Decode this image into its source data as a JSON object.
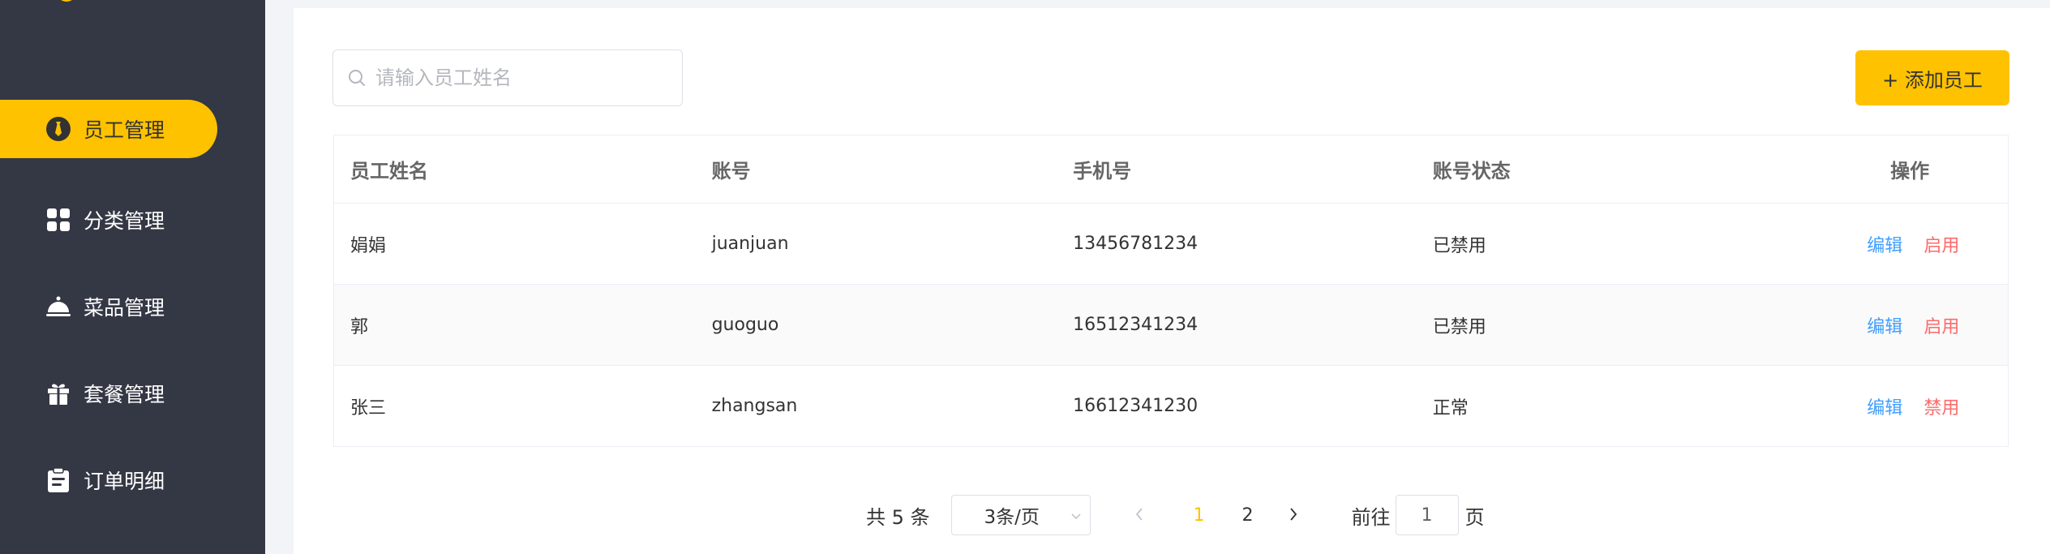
{
  "sidebar": {
    "items": [
      {
        "label": "员工管理",
        "icon": "tie-icon",
        "active": true
      },
      {
        "label": "分类管理",
        "icon": "grid-icon",
        "active": false
      },
      {
        "label": "菜品管理",
        "icon": "cloche-icon",
        "active": false
      },
      {
        "label": "套餐管理",
        "icon": "gift-icon",
        "active": false
      },
      {
        "label": "订单明细",
        "icon": "clipboard-icon",
        "active": false
      }
    ]
  },
  "search": {
    "placeholder": "请输入员工姓名",
    "value": ""
  },
  "toolbar": {
    "add_label": "+ 添加员工"
  },
  "table": {
    "columns": [
      "员工姓名",
      "账号",
      "手机号",
      "账号状态",
      "操作"
    ],
    "rows": [
      {
        "name": "娟娟",
        "account": "juanjuan",
        "phone": "13456781234",
        "status": "已禁用",
        "edit": "编辑",
        "toggle": "启用"
      },
      {
        "name": "郭",
        "account": "guoguo",
        "phone": "16512341234",
        "status": "已禁用",
        "edit": "编辑",
        "toggle": "启用"
      },
      {
        "name": "张三",
        "account": "zhangsan",
        "phone": "16612341230",
        "status": "正常",
        "edit": "编辑",
        "toggle": "禁用"
      }
    ]
  },
  "pagination": {
    "total_text": "共 5 条",
    "page_size": "3条/页",
    "pages": [
      "1",
      "2"
    ],
    "current_page": "1",
    "goto_label": "前往",
    "goto_value": "1",
    "goto_suffix": "页"
  },
  "colors": {
    "accent": "#ffc200",
    "sidebar_bg": "#343744",
    "edit_link": "#419eff",
    "toggle_link": "#fd6a6a"
  }
}
